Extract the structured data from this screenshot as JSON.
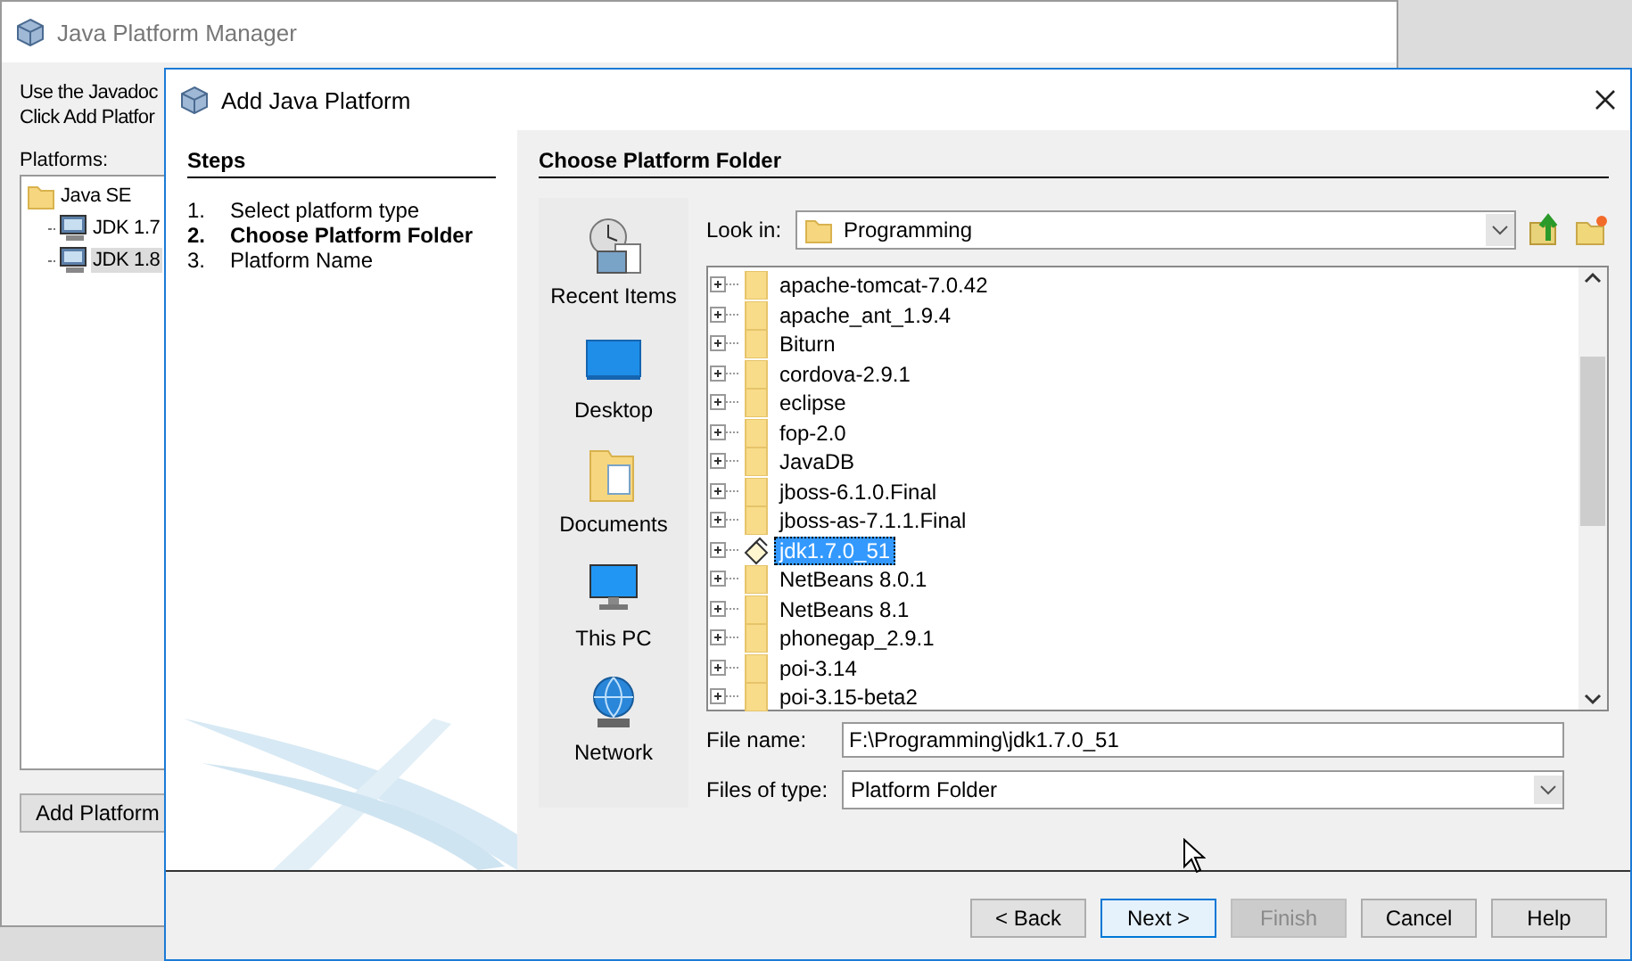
{
  "background_window": {
    "title": "Java Platform Manager",
    "description_lines": [
      "Use the Javadoc",
      "Click Add Platfor"
    ],
    "platforms_label": "Platforms:",
    "platforms": [
      {
        "label": "Java SE",
        "kind": "folder",
        "selected": false,
        "children": [
          {
            "label": "JDK 1.7",
            "kind": "jdk",
            "selected": false
          },
          {
            "label": "JDK 1.8",
            "kind": "jdk",
            "selected": true
          }
        ]
      }
    ],
    "add_button": "Add Platform"
  },
  "dialog": {
    "title": "Add Java Platform",
    "steps_title": "Steps",
    "steps": [
      {
        "number": "1.",
        "label": "Select platform type",
        "selected": false
      },
      {
        "number": "2.",
        "label": "Choose Platform Folder",
        "selected": true
      },
      {
        "number": "3.",
        "label": "Platform Name",
        "selected": false
      }
    ],
    "panel_title": "Choose Platform Folder",
    "places": [
      {
        "kind": "recent",
        "label": "Recent Items"
      },
      {
        "kind": "desktop",
        "label": "Desktop"
      },
      {
        "kind": "documents",
        "label": "Documents"
      },
      {
        "kind": "pc",
        "label": "This PC"
      },
      {
        "kind": "network",
        "label": "Network"
      }
    ],
    "look_in": {
      "label": "Look in:",
      "value": "Programming"
    },
    "files": [
      {
        "name": "apache-tomcat-7.0.42",
        "kind": "folder",
        "selected": false
      },
      {
        "name": "apache_ant_1.9.4",
        "kind": "folder",
        "selected": false
      },
      {
        "name": "Biturn",
        "kind": "folder",
        "selected": false
      },
      {
        "name": "cordova-2.9.1",
        "kind": "folder",
        "selected": false
      },
      {
        "name": "eclipse",
        "kind": "folder",
        "selected": false
      },
      {
        "name": "fop-2.0",
        "kind": "folder",
        "selected": false
      },
      {
        "name": "JavaDB",
        "kind": "folder",
        "selected": false
      },
      {
        "name": "jboss-6.1.0.Final",
        "kind": "folder",
        "selected": false
      },
      {
        "name": "jboss-as-7.1.1.Final",
        "kind": "folder",
        "selected": false
      },
      {
        "name": "jdk1.7.0_51",
        "kind": "platform",
        "selected": true
      },
      {
        "name": "NetBeans 8.0.1",
        "kind": "folder",
        "selected": false
      },
      {
        "name": "NetBeans 8.1",
        "kind": "folder",
        "selected": false
      },
      {
        "name": "phonegap_2.9.1",
        "kind": "folder",
        "selected": false
      },
      {
        "name": "poi-3.14",
        "kind": "folder",
        "selected": false
      },
      {
        "name": "poi-3.15-beta2",
        "kind": "folder",
        "selected": false
      }
    ],
    "file_name": {
      "label": "File name:",
      "value": "F:\\Programming\\jdk1.7.0_51"
    },
    "file_type": {
      "label": "Files of type:",
      "value": "Platform Folder"
    },
    "buttons": [
      {
        "label": "< Back",
        "disabled": false,
        "focused": false
      },
      {
        "label": "Next >",
        "disabled": false,
        "focused": true
      },
      {
        "label": "Finish",
        "disabled": true,
        "focused": false
      },
      {
        "label": "Cancel",
        "disabled": false,
        "focused": false
      },
      {
        "label": "Help",
        "disabled": false,
        "focused": false
      }
    ]
  }
}
